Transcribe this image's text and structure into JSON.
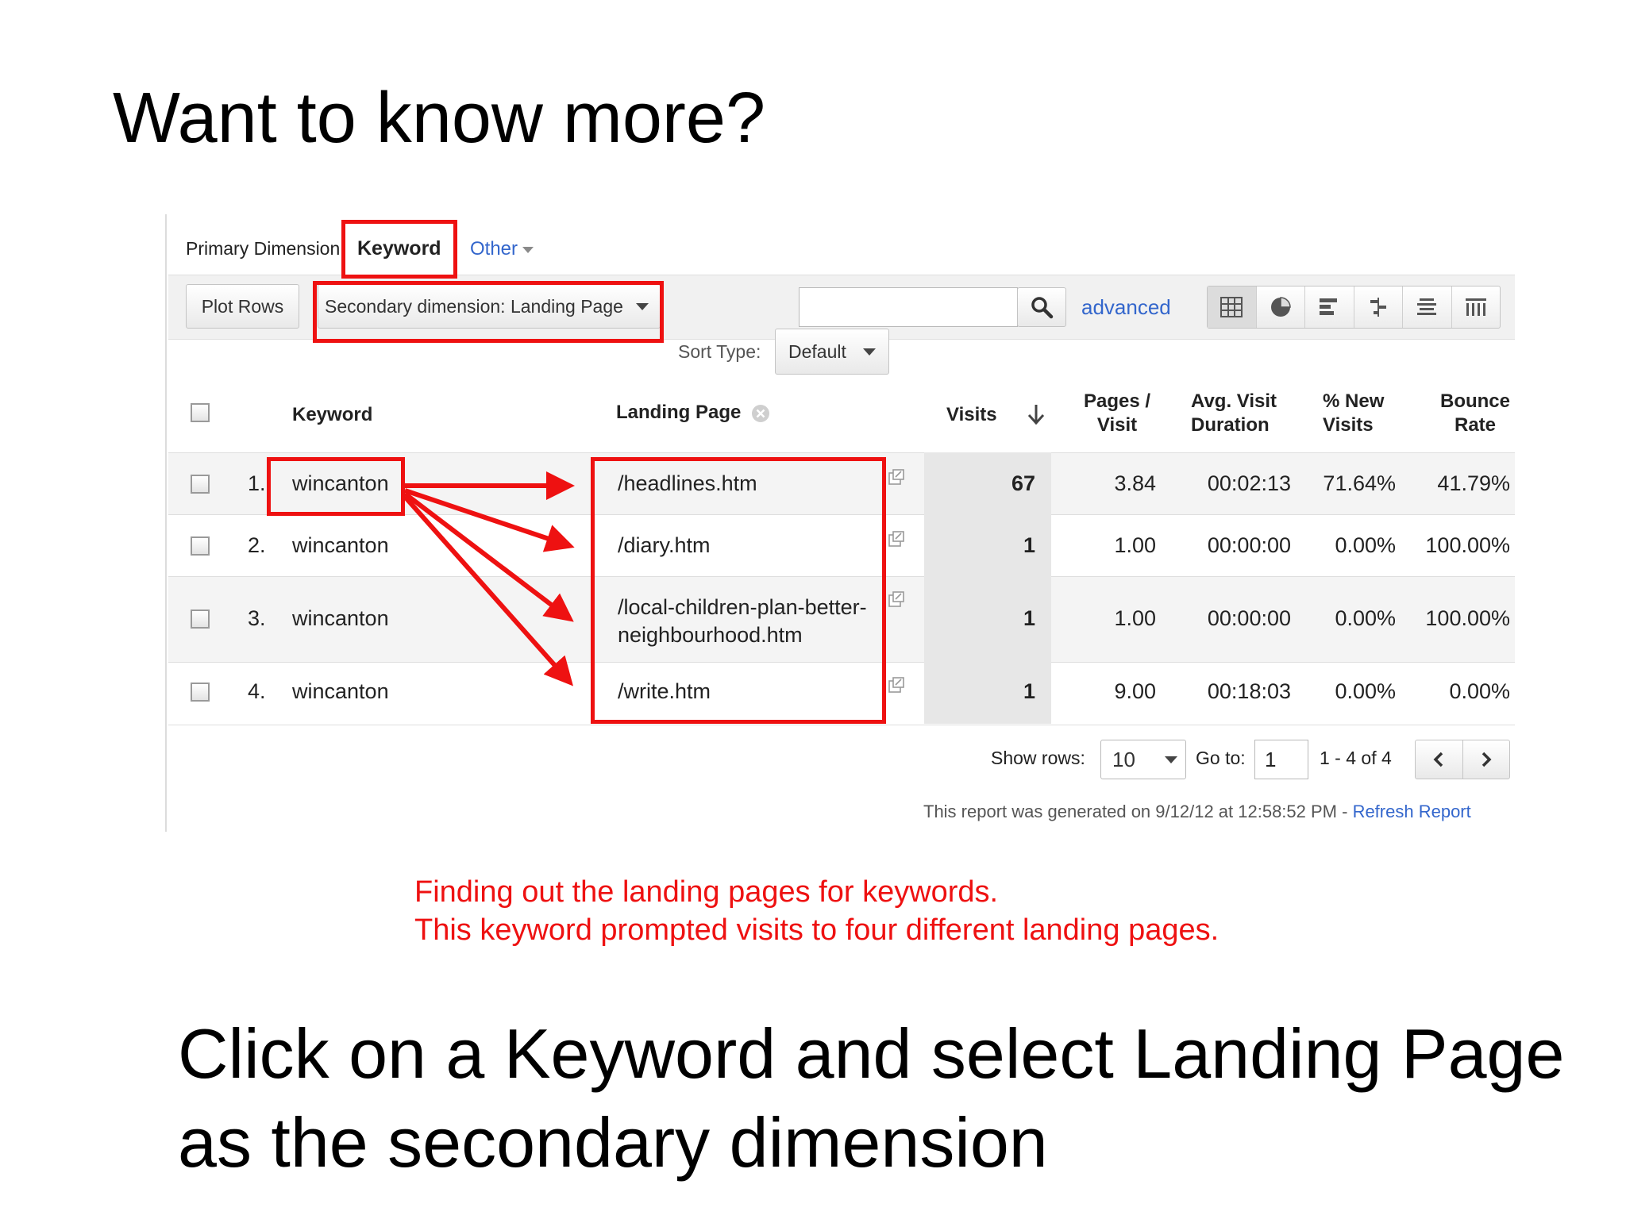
{
  "slide": {
    "title": "Want to know more?",
    "caption_line1": "Finding out the landing pages for keywords.",
    "caption_line2": "This keyword prompted visits to four different landing pages.",
    "body": "Click on a Keyword and select Landing Page as the secondary dimension"
  },
  "report": {
    "primary_dimension_label": "Primary Dimension:",
    "primary_dimension_value": "Keyword",
    "other_label": "Other",
    "plot_rows_label": "Plot Rows",
    "secondary_dimension_label": "Secondary dimension: Landing Page",
    "search_value": "",
    "advanced_label": "advanced",
    "sort_type_label": "Sort Type:",
    "sort_type_value": "Default",
    "columns": {
      "keyword": "Keyword",
      "landing_page": "Landing Page",
      "visits": "Visits",
      "pages_visit_1": "Pages /",
      "pages_visit_2": "Visit",
      "avg_duration_1": "Avg. Visit",
      "avg_duration_2": "Duration",
      "new_visits_1": "% New",
      "new_visits_2": "Visits",
      "bounce_1": "Bounce",
      "bounce_2": "Rate"
    },
    "rows": [
      {
        "index": "1.",
        "keyword": "wincanton",
        "page_line1": "/headlines.htm",
        "page_line2": "",
        "visits": "67",
        "pages_per_visit": "3.84",
        "avg_duration": "00:02:13",
        "new_visits": "71.64%",
        "bounce_rate": "41.79%"
      },
      {
        "index": "2.",
        "keyword": "wincanton",
        "page_line1": "/diary.htm",
        "page_line2": "",
        "visits": "1",
        "pages_per_visit": "1.00",
        "avg_duration": "00:00:00",
        "new_visits": "0.00%",
        "bounce_rate": "100.00%"
      },
      {
        "index": "3.",
        "keyword": "wincanton",
        "page_line1": "/local-children-plan-better-",
        "page_line2": "neighbourhood.htm",
        "visits": "1",
        "pages_per_visit": "1.00",
        "avg_duration": "00:00:00",
        "new_visits": "0.00%",
        "bounce_rate": "100.00%"
      },
      {
        "index": "4.",
        "keyword": "wincanton",
        "page_line1": "/write.htm",
        "page_line2": "",
        "visits": "1",
        "pages_per_visit": "9.00",
        "avg_duration": "00:18:03",
        "new_visits": "0.00%",
        "bounce_rate": "0.00%"
      }
    ],
    "pager": {
      "show_rows_label": "Show rows:",
      "show_rows_value": "10",
      "go_to_label": "Go to:",
      "go_to_value": "1",
      "range_text": "1 - 4 of 4"
    },
    "generated_note": "This report was generated on 9/12/12 at 12:58:52 PM -",
    "refresh_label": "Refresh Report"
  },
  "colors": {
    "annotation_red": "#ee1111",
    "link_blue": "#3366cc",
    "visits_column_bg": "#e7e7e7"
  }
}
